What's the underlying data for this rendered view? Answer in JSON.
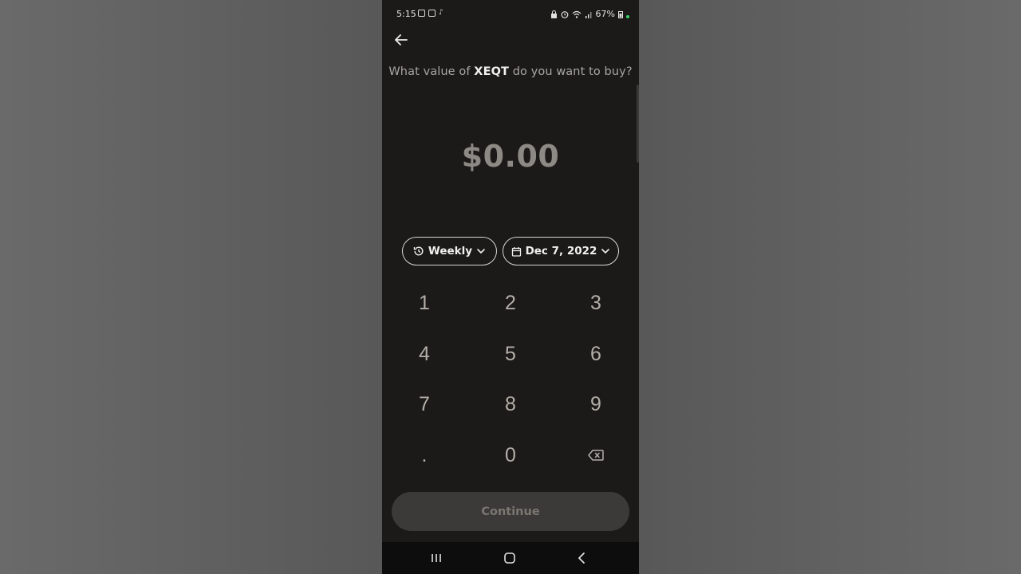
{
  "status_bar": {
    "time": "5:15",
    "battery": "67%"
  },
  "question": {
    "prefix": "What value of ",
    "ticker": "XEQT",
    "suffix": " do you want to buy?"
  },
  "amount": "$0.00",
  "frequency": {
    "label": "Weekly",
    "icon": "history-icon"
  },
  "start_date": {
    "label": "Dec 7, 2022",
    "icon": "calendar-icon"
  },
  "keypad": {
    "k1": "1",
    "k2": "2",
    "k3": "3",
    "k4": "4",
    "k5": "5",
    "k6": "6",
    "k7": "7",
    "k8": "8",
    "k9": "9",
    "kdot": ".",
    "k0": "0",
    "backspace_icon": "backspace-icon"
  },
  "continue_label": "Continue",
  "colors": {
    "background": "#1b1a19",
    "amount": "#8d8a85",
    "button_disabled": "#3b3a38"
  }
}
